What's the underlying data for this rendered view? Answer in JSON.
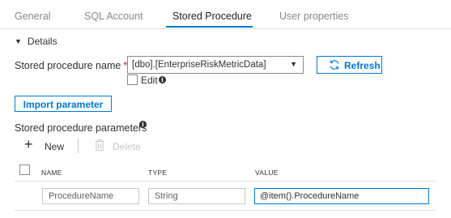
{
  "tabs": [
    {
      "label": "General",
      "active": false
    },
    {
      "label": "SQL Account",
      "active": false
    },
    {
      "label": "Stored Procedure",
      "active": true
    },
    {
      "label": "User properties",
      "active": false
    }
  ],
  "details": {
    "toggle_label": "Details",
    "stored_procedure_label": "Stored procedure name",
    "required_marker": "*",
    "stored_procedure_value": "[dbo].[EnterpriseRiskMetricData]",
    "refresh_label": "Refresh",
    "edit_label": "Edit",
    "edit_checked": false,
    "info_glyph": "i",
    "import_parameter_label": "Import parameter",
    "params_label": "Stored procedure parameters"
  },
  "toolbar": {
    "new_label": "New",
    "delete_label": "Delete"
  },
  "table": {
    "columns": [
      "NAME",
      "TYPE",
      "VALUE"
    ],
    "rows": [
      {
        "name": "ProcedureName",
        "type": "String",
        "value": "@item().ProcedureName"
      }
    ]
  },
  "colors": {
    "accent": "#0078d4",
    "required": "#a4262c",
    "disabled": "#c8c6c4"
  },
  "icons": {
    "details-toggle": "triangle-down-icon",
    "refresh": "refresh-icon",
    "info": "info-icon",
    "new": "plus-icon",
    "delete": "trash-icon"
  }
}
